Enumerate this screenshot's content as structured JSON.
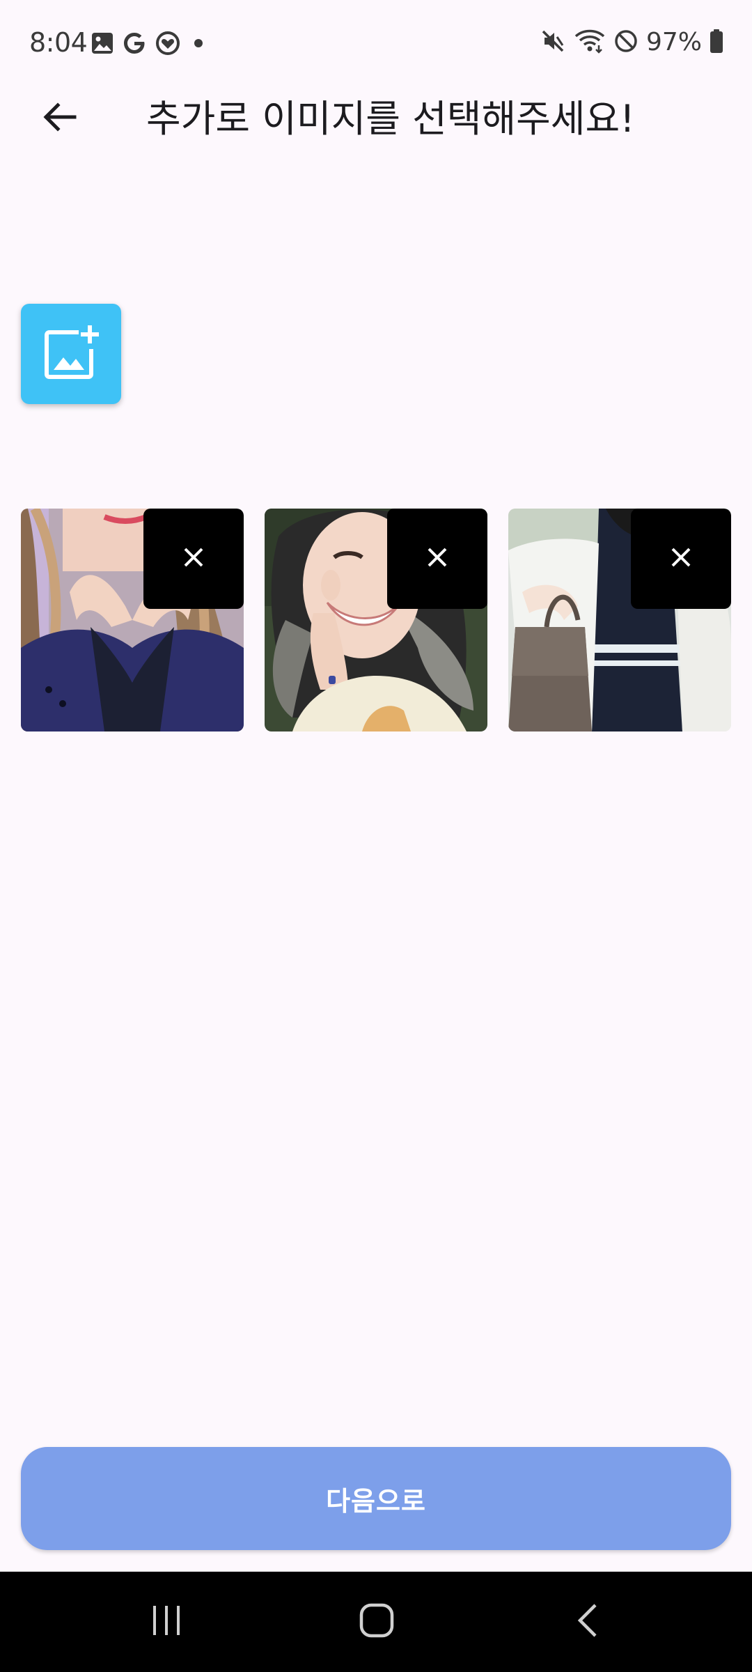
{
  "status_bar": {
    "time": "8:04",
    "left_icons": [
      "gallery-icon",
      "google-icon",
      "heart-badge-icon",
      "dot-icon"
    ],
    "right_icons": [
      "mute-icon",
      "wifi-icon",
      "block-icon",
      "battery-icon"
    ],
    "battery": "97%"
  },
  "app_bar": {
    "back_icon": "arrow-back-icon",
    "title": "추가로 이미지를 선택해주세요!"
  },
  "add_image": {
    "icon": "add-photo-icon",
    "color": "#3fc2f6"
  },
  "images": [
    {
      "remove_icon": "close-icon"
    },
    {
      "remove_icon": "close-icon"
    },
    {
      "remove_icon": "close-icon"
    }
  ],
  "next_button": {
    "label": "다음으로",
    "color": "#7d9fea"
  },
  "nav_bar": {
    "items": [
      "recents-icon",
      "home-icon",
      "back-icon"
    ]
  }
}
